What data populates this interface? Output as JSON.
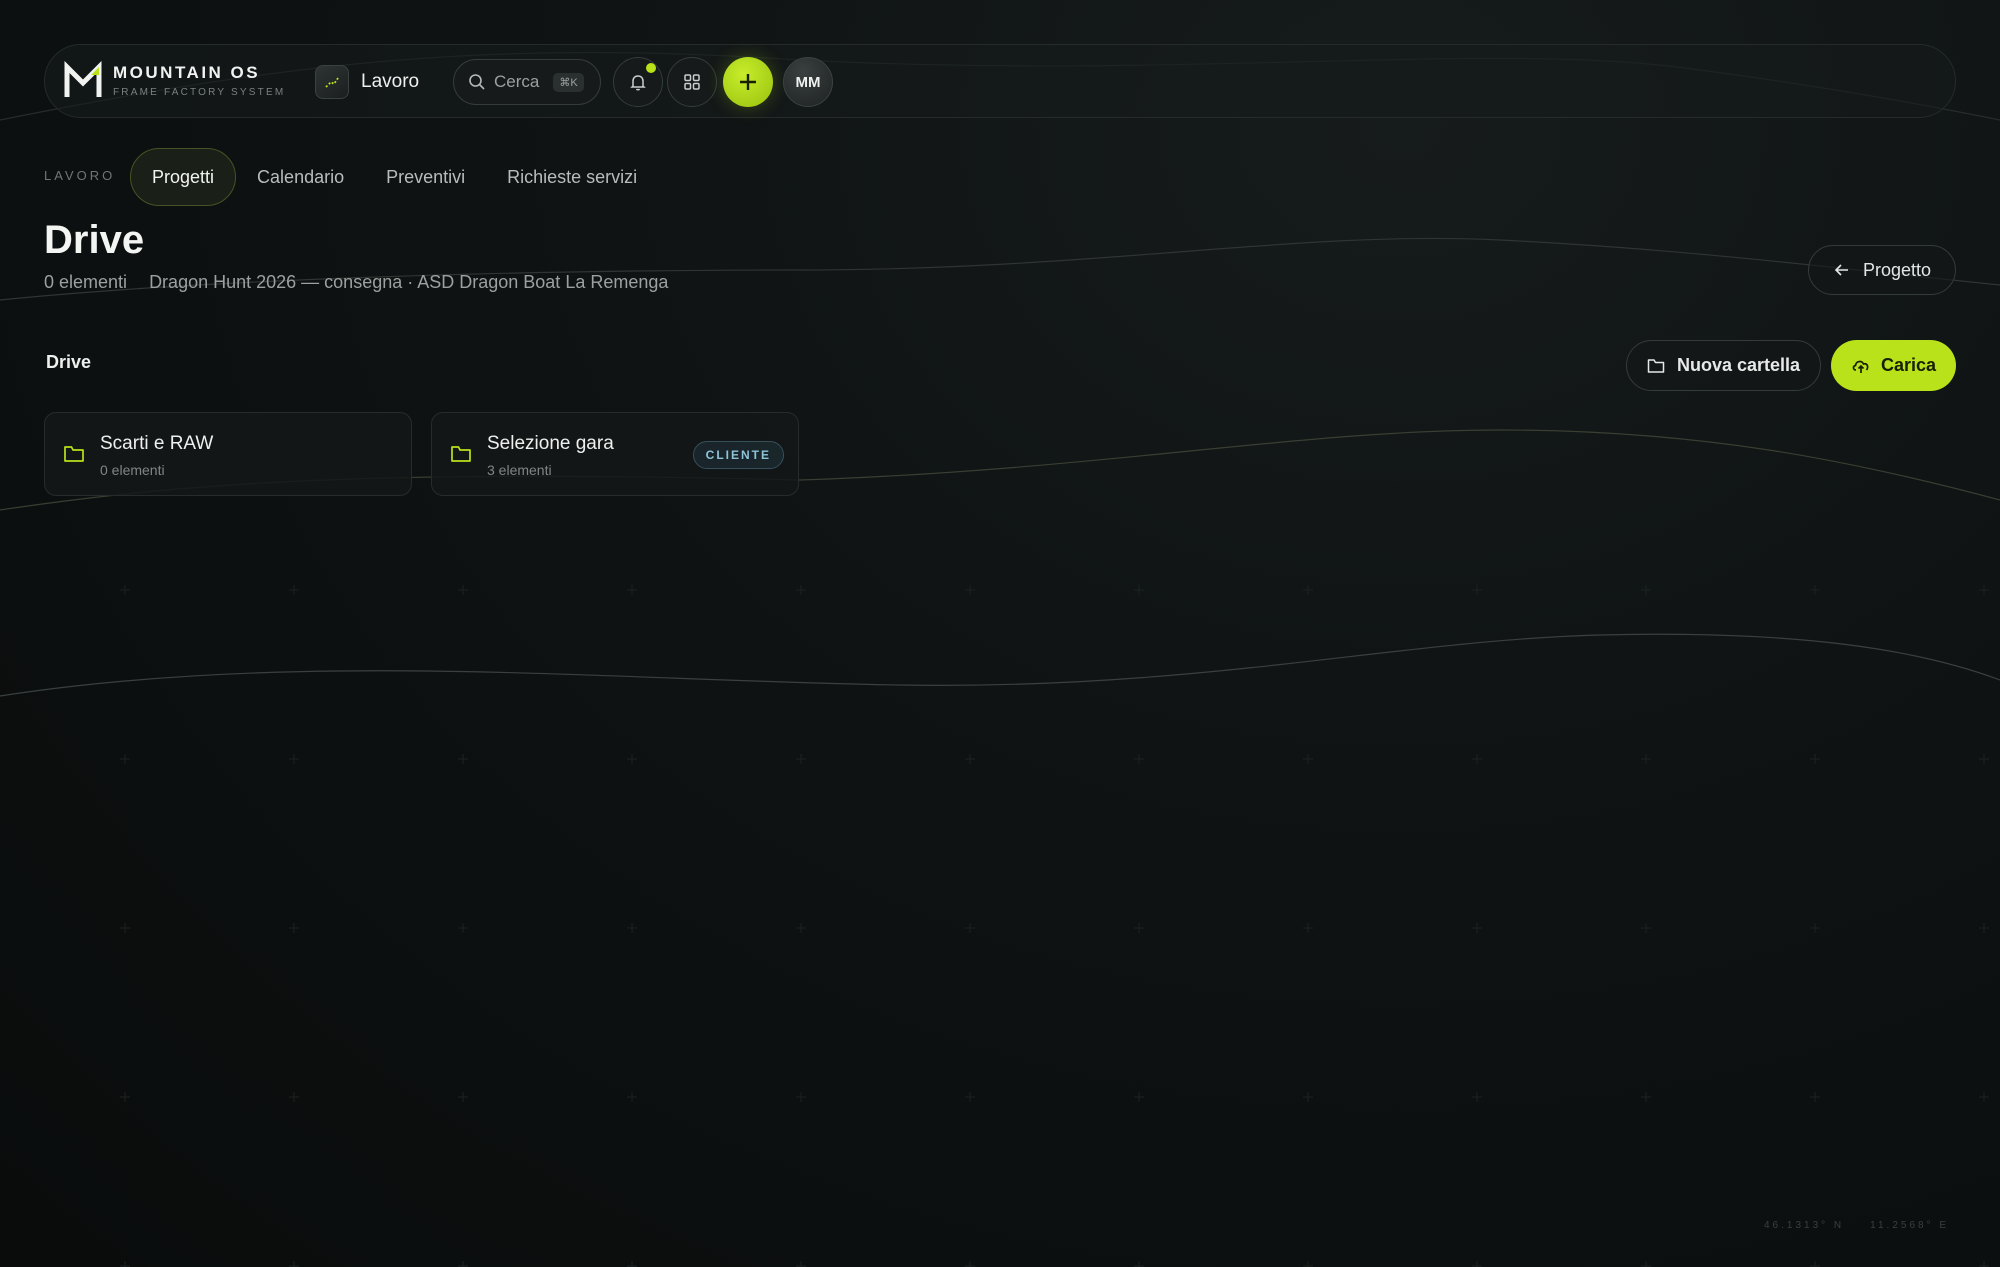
{
  "brand": {
    "title": "MOUNTAIN OS",
    "subtitle": "FRAME FACTORY SYSTEM",
    "logo_icon": "mountain-m-logo"
  },
  "workspace": {
    "label": "Lavoro",
    "icon": "workspace-chart-icon"
  },
  "search": {
    "label": "Cerca",
    "shortcut": "⌘K",
    "icon": "search-icon"
  },
  "toolbar_icons": {
    "notifications": "bell-icon",
    "apps": "grid-icon",
    "add": "plus-icon"
  },
  "user": {
    "initials": "MM"
  },
  "subnav": {
    "section": "LAVORO",
    "tabs": [
      {
        "label": "Progetti",
        "active": true
      },
      {
        "label": "Calendario",
        "active": false
      },
      {
        "label": "Preventivi",
        "active": false
      },
      {
        "label": "Richieste servizi",
        "active": false
      }
    ]
  },
  "page": {
    "title": "Drive",
    "count": "0 elementi",
    "context": "Dragon Hunt 2026 — consegna · ASD Dragon Boat La Remenga",
    "back_label": "Progetto"
  },
  "drive": {
    "label": "Drive",
    "new_folder_label": "Nuova cartella",
    "upload_label": "Carica",
    "folders": [
      {
        "name": "Scarti e RAW",
        "count": "0 elementi",
        "badge": ""
      },
      {
        "name": "Selezione gara",
        "count": "3 elementi",
        "badge": "CLIENTE"
      }
    ]
  },
  "coordinates": {
    "lat": "46.1313° N",
    "lon": "11.2568° E"
  },
  "colors": {
    "accent": "#b9e21b",
    "background": "#0f1313",
    "badge_text": "#8ec3d8"
  }
}
